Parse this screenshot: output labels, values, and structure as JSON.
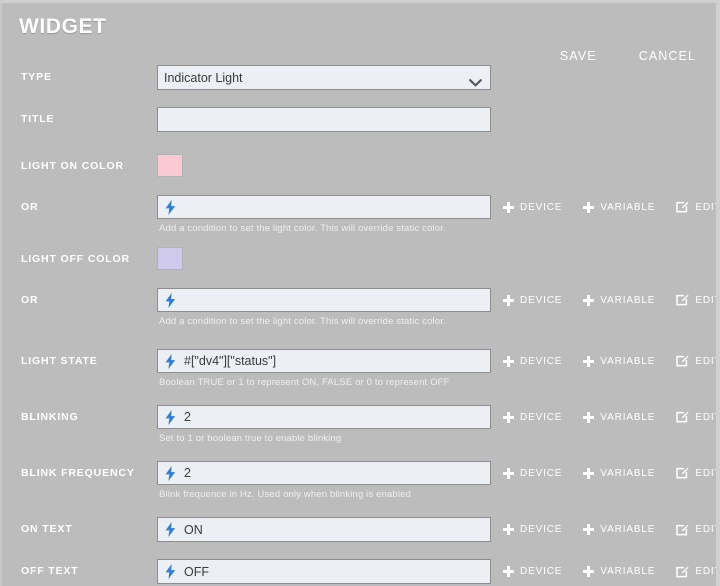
{
  "window": {
    "title": "WIDGET",
    "background": "#bcbcbc"
  },
  "header": {
    "save_label": "SAVE",
    "cancel_label": "CANCEL"
  },
  "icons": {
    "bolt": "lightning-bolt-icon",
    "plus": "plus-icon",
    "editor": "edit-square-icon",
    "chevron": "chevron-down-icon"
  },
  "field_actions": {
    "device_label": "DEVICE",
    "variable_label": "VARIABLE",
    "editor_label": "EDITOR"
  },
  "rows": {
    "type": {
      "label": "TYPE",
      "value": "Indicator Light"
    },
    "title": {
      "label": "TITLE",
      "value": "",
      "placeholder": ""
    },
    "light_on_color": {
      "label": "LIGHT ON COLOR",
      "color": "#fbc9d3"
    },
    "or_on": {
      "label": "OR",
      "value": "",
      "helper": "Add a condition to set the light color. This will override static color."
    },
    "light_off_color": {
      "label": "LIGHT OFF COLOR",
      "color": "#cfc9ec"
    },
    "or_off": {
      "label": "OR",
      "value": "",
      "helper": "Add a condition to set the light color. This will override static color."
    },
    "light_state": {
      "label": "LIGHT STATE",
      "value": "#[\"dv4\"][\"status\"]",
      "helper": "Boolean TRUE or 1 to represent ON, FALSE or 0 to represent OFF"
    },
    "blinking": {
      "label": "BLINKING",
      "value": "2",
      "helper": "Set to 1 or boolean true to enable blinking"
    },
    "blink_frequency": {
      "label": "BLINK FREQUENCY",
      "value": "2",
      "helper": "Blink frequence in Hz. Used only when blinking is enabled"
    },
    "on_text": {
      "label": "ON TEXT",
      "value": "ON"
    },
    "off_text": {
      "label": "OFF TEXT",
      "value": "OFF"
    }
  },
  "colors": {
    "accent_bolt": "#2f7fd8",
    "input_bg": "#eceff3",
    "input_border": "#8d8d8d",
    "label_text": "#ffffff",
    "helper_text": "#efefef"
  }
}
